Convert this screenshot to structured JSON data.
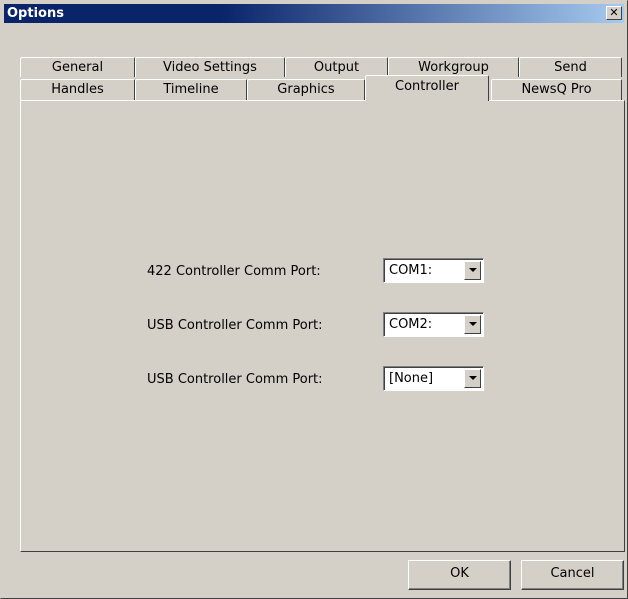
{
  "window": {
    "title": "Options",
    "close_glyph": "✕"
  },
  "tabs_row1": [
    "General",
    "Video Settings",
    "Output",
    "Workgroup",
    "Send"
  ],
  "tabs_row2": [
    "Handles",
    "Timeline",
    "Graphics",
    "Controller",
    "NewsQ Pro"
  ],
  "active_tab": "Controller",
  "controller": {
    "rows": [
      {
        "label": "422 Controller Comm Port:",
        "value": "COM1:"
      },
      {
        "label": "USB Controller Comm Port:",
        "value": "COM2:"
      },
      {
        "label": "USB Controller Comm Port:",
        "value": "[None]"
      }
    ]
  },
  "buttons": {
    "ok": "OK",
    "cancel": "Cancel"
  }
}
